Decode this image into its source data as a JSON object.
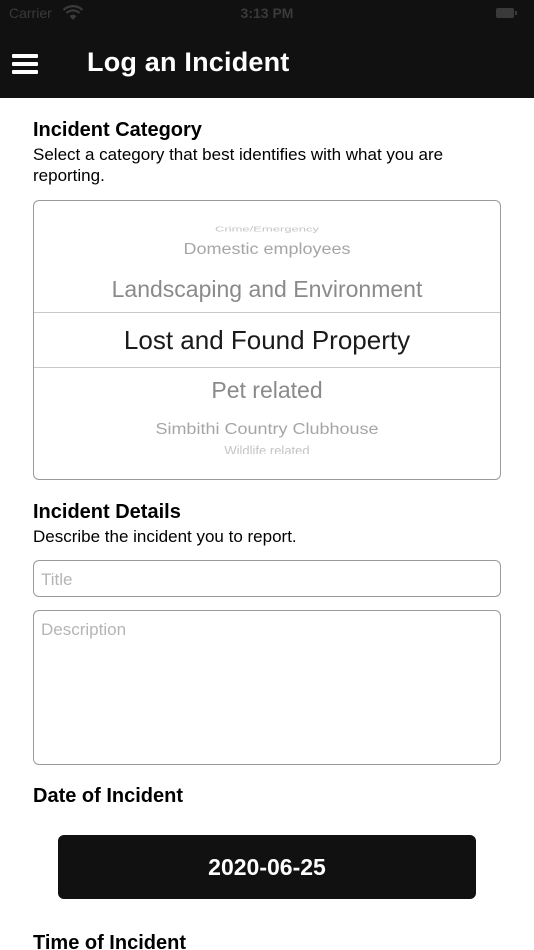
{
  "status_bar": {
    "carrier": "Carrier",
    "time": "3:13 PM"
  },
  "header": {
    "title": "Log an Incident",
    "menu_icon": "hamburger-menu-icon"
  },
  "category": {
    "title": "Incident Category",
    "description": "Select a category that best identifies with what you are reporting.",
    "options": [
      "Crime/Emergency",
      "Domestic employees",
      "Landscaping and Environment",
      "Lost and Found Property",
      "Pet related",
      "Simbithi Country Clubhouse",
      "Wildlife related"
    ],
    "selected": "Lost and Found Property"
  },
  "details": {
    "title": "Incident Details",
    "description": "Describe the incident you to report.",
    "title_placeholder": "Title",
    "description_placeholder": "Description"
  },
  "date": {
    "title": "Date of Incident",
    "value": "2020-06-25"
  },
  "time": {
    "title": "Time of Incident"
  }
}
